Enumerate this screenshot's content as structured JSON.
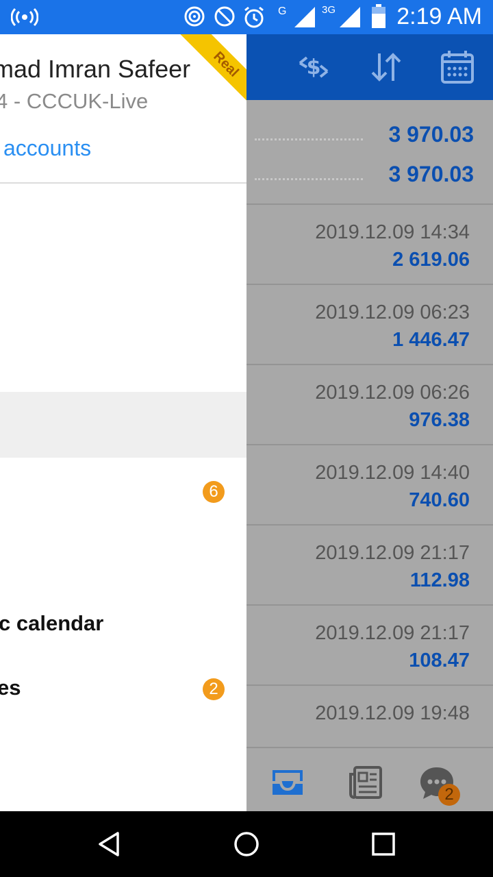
{
  "status_bar": {
    "time": "2:19 AM",
    "network_label": "G",
    "network_3g": "3G",
    "icons": [
      "hotspot-icon",
      "nfc-icon",
      "do-not-disturb-icon",
      "alarm-icon",
      "signal-icon",
      "signal-3g-icon",
      "battery-icon"
    ]
  },
  "drawer": {
    "user_name": "mad Imran Safeer",
    "account_line": "4 - CCCUK-Live",
    "manage_accounts": "accounts",
    "ribbon": "Real",
    "menu": [
      {
        "label": "",
        "badge": "6"
      },
      {
        "label": "c calendar",
        "badge": ""
      },
      {
        "label": "es",
        "badge": "2"
      }
    ]
  },
  "panel": {
    "balances": [
      "3 970.03",
      "3 970.03"
    ],
    "deals": [
      {
        "datetime": "2019.12.09 14:34",
        "amount": "2 619.06"
      },
      {
        "datetime": "2019.12.09 06:23",
        "amount": "1 446.47"
      },
      {
        "datetime": "2019.12.09 06:26",
        "amount": "976.38"
      },
      {
        "datetime": "2019.12.09 14:40",
        "amount": "740.60"
      },
      {
        "datetime": "2019.12.09 21:17",
        "amount": "112.98"
      },
      {
        "datetime": "2019.12.09 21:17",
        "amount": "108.47"
      },
      {
        "datetime": "2019.12.09 19:48",
        "amount": ""
      }
    ],
    "chat_badge": "2"
  },
  "colors": {
    "status_bar": "#1a73e8",
    "app_bar": "#0b52b3",
    "value_blue": "#0b4fb0",
    "link_blue": "#2a8ff2",
    "badge_orange": "#f29b1c",
    "ribbon_yellow": "#f5c400"
  }
}
